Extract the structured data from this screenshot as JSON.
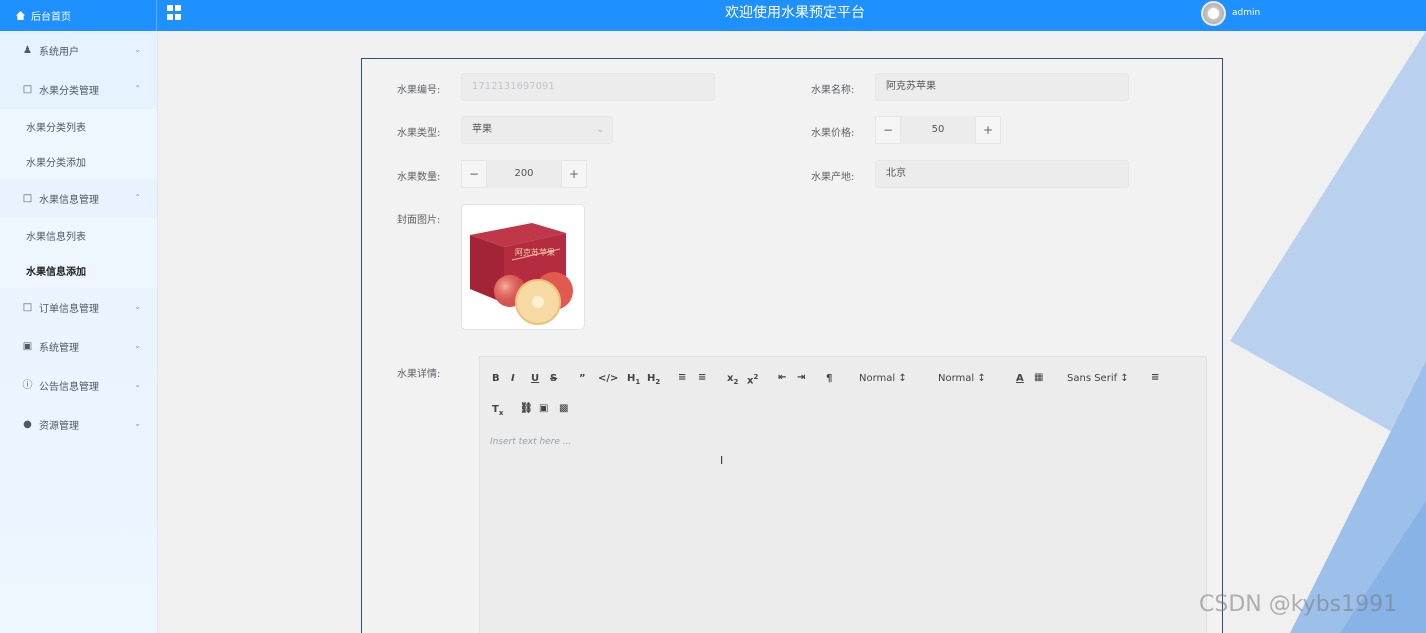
{
  "header": {
    "brand": "后台首页",
    "title": "欢迎使用水果预定平台",
    "username": "admin"
  },
  "sidebar": {
    "items": [
      {
        "label": "系统用户",
        "icon": "user-icon"
      },
      {
        "label": "水果分类管理",
        "icon": "folder-icon"
      },
      {
        "label": "水果分类列表"
      },
      {
        "label": "水果分类添加"
      },
      {
        "label": "水果信息管理",
        "icon": "folder-icon"
      },
      {
        "label": "水果信息列表"
      },
      {
        "label": "水果信息添加"
      },
      {
        "label": "订单信息管理",
        "icon": "folder-icon"
      },
      {
        "label": "系统管理",
        "icon": "image-icon"
      },
      {
        "label": "公告信息管理",
        "icon": "info-icon"
      },
      {
        "label": "资源管理",
        "icon": "pin-icon"
      }
    ]
  },
  "form": {
    "code_label": "水果编号:",
    "code_value": "1712131697091",
    "name_label": "水果名称:",
    "name_value": "阿克苏苹果",
    "type_label": "水果类型:",
    "type_value": "苹果",
    "price_label": "水果价格:",
    "price_value": "50",
    "qty_label": "水果数量:",
    "qty_value": "200",
    "origin_label": "水果产地:",
    "origin_value": "北京",
    "cover_label": "封面图片:",
    "detail_label": "水果详情:",
    "box_text": "阿克苏苹果"
  },
  "editor": {
    "header_select": "Normal",
    "size_select": "Normal",
    "font_select": "Sans Serif",
    "placeholder": "Insert text here ..."
  },
  "watermark": "CSDN @kybs1991",
  "colors": {
    "header": "#1e90ff",
    "panel_border": "#33507a"
  }
}
